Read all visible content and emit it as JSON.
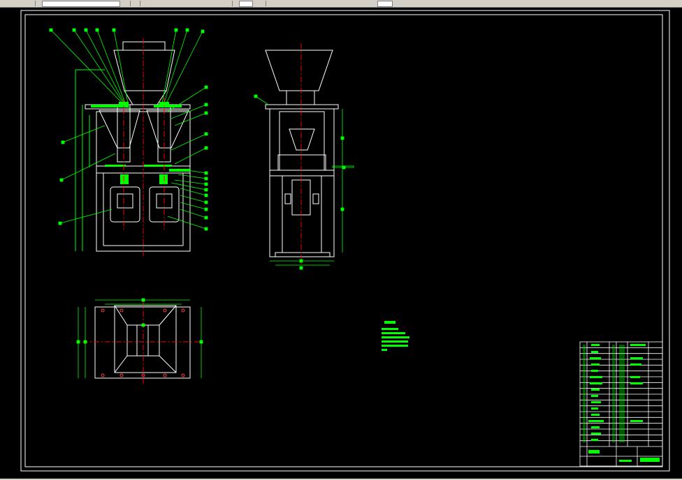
{
  "colors": {
    "background": "#000000",
    "frame": "#ffffff",
    "leader": "#00ff00",
    "centerline": "#ff0000",
    "annotation_text": "#00ff00"
  },
  "toolbar": {
    "icons": [
      "file-icon",
      "layer-dropdown",
      "grip-icon",
      "properties-icon",
      "zoom-icon",
      "linetype-icon",
      "color-icon"
    ]
  },
  "views": [
    "front-view",
    "side-view",
    "top-view"
  ],
  "title_block": {
    "rows": 18
  },
  "notes": {
    "lines": 6
  }
}
